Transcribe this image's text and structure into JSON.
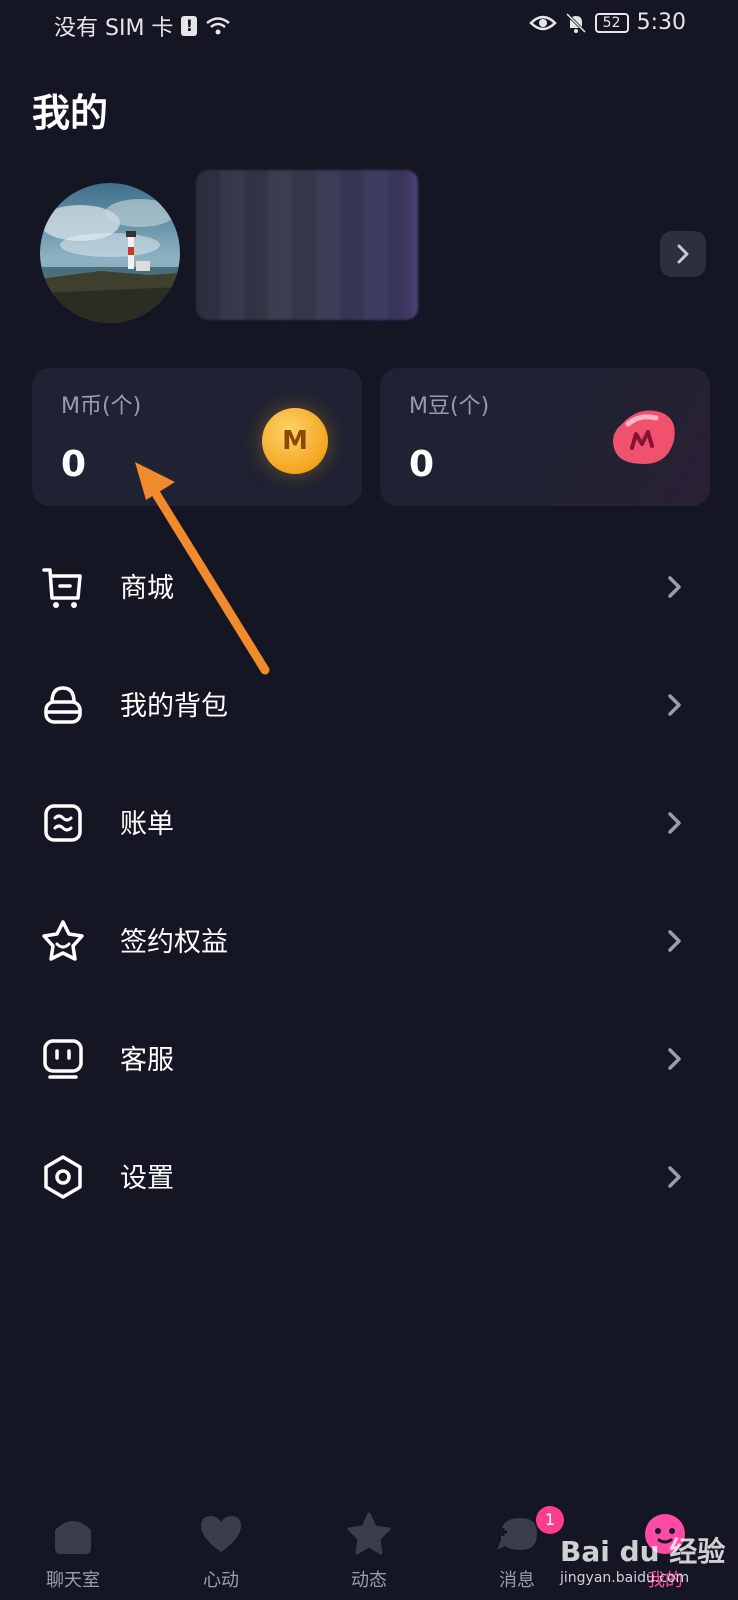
{
  "status_bar": {
    "carrier": "没有 SIM 卡",
    "battery": "52",
    "time": "5:30"
  },
  "header": {
    "title": "我的"
  },
  "wallet": {
    "coin": {
      "label": "M币(个)",
      "value": "0",
      "icon_text": "M"
    },
    "bean": {
      "label": "M豆(个)",
      "value": "0"
    }
  },
  "menu": [
    {
      "label": "商城",
      "icon": "cart-icon"
    },
    {
      "label": "我的背包",
      "icon": "backpack-icon"
    },
    {
      "label": "账单",
      "icon": "bill-icon"
    },
    {
      "label": "签约权益",
      "icon": "star-badge-icon"
    },
    {
      "label": "客服",
      "icon": "service-icon"
    },
    {
      "label": "设置",
      "icon": "settings-icon"
    }
  ],
  "tabs": [
    {
      "label": "聊天室",
      "icon": "home-icon"
    },
    {
      "label": "心动",
      "icon": "heart-icon"
    },
    {
      "label": "动态",
      "icon": "star-icon"
    },
    {
      "label": "消息",
      "icon": "message-icon",
      "badge": "1"
    },
    {
      "label": "我的",
      "icon": "profile-face-icon",
      "active": true
    }
  ],
  "watermark": {
    "brand": "Bai du 经验",
    "url": "jingyan.baidu.com"
  },
  "colors": {
    "background": "#141624",
    "card": "#1f2232",
    "accent_pink": "#ff4aa6",
    "coin_orange": "#f3a520",
    "annotation_arrow": "#f08a2c"
  }
}
